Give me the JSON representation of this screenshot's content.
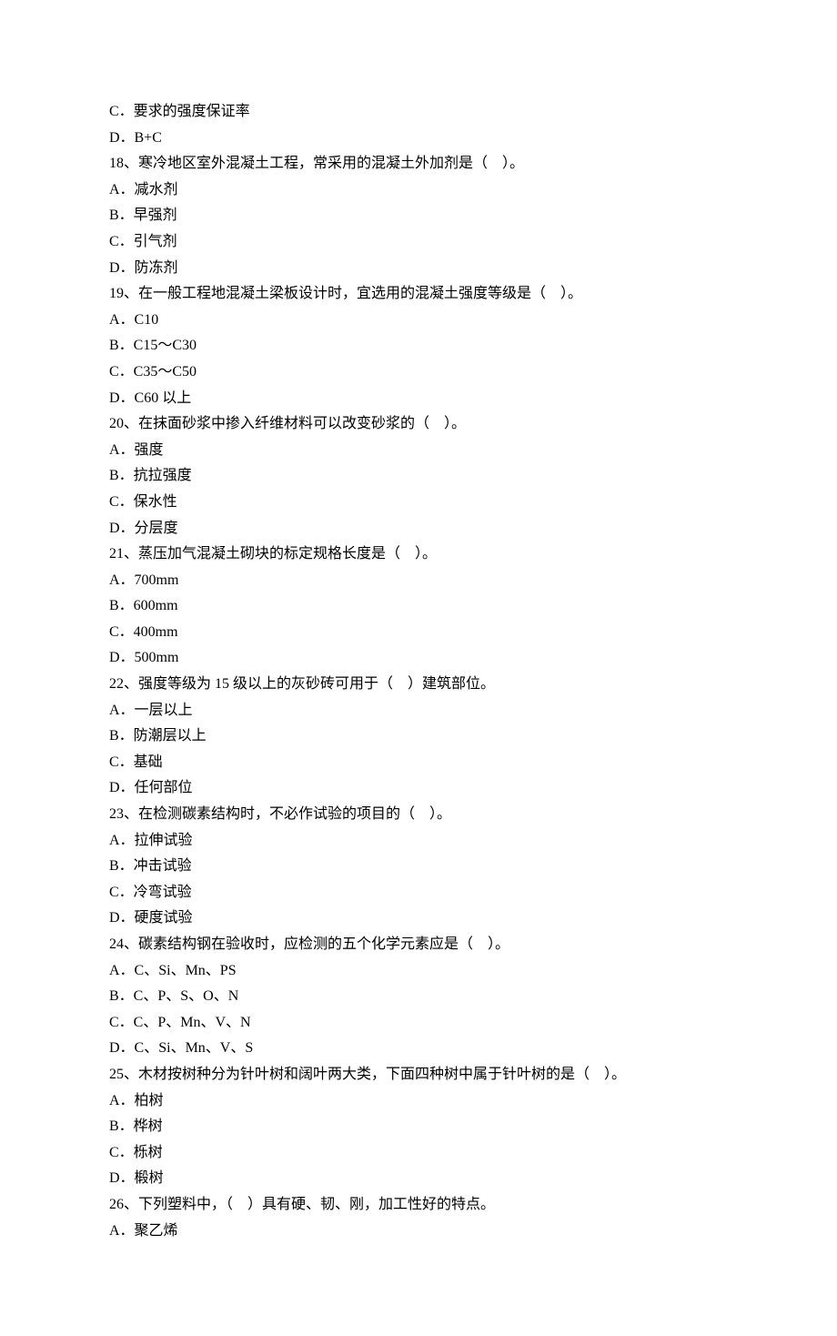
{
  "lines": [
    {
      "type": "option",
      "text": "C．要求的强度保证率"
    },
    {
      "type": "option",
      "text": "D．B+C"
    },
    {
      "type": "question",
      "text": "18、寒冷地区室外混凝土工程，常采用的混凝土外加剂是（　）。"
    },
    {
      "type": "option",
      "text": "A．减水剂"
    },
    {
      "type": "option",
      "text": "B．早强剂"
    },
    {
      "type": "option",
      "text": "C．引气剂"
    },
    {
      "type": "option",
      "text": "D．防冻剂"
    },
    {
      "type": "question",
      "text": "19、在一般工程地混凝土梁板设计时，宜选用的混凝土强度等级是（　）。"
    },
    {
      "type": "option",
      "text": "A．C10"
    },
    {
      "type": "option",
      "text": "B．C15～C30"
    },
    {
      "type": "option",
      "text": "C．C35～C50"
    },
    {
      "type": "option",
      "text": "D．C60 以上"
    },
    {
      "type": "question",
      "text": "20、在抹面砂浆中掺入纤维材料可以改变砂浆的（　）。"
    },
    {
      "type": "option",
      "text": "A．强度"
    },
    {
      "type": "option",
      "text": "B．抗拉强度"
    },
    {
      "type": "option",
      "text": "C．保水性"
    },
    {
      "type": "option",
      "text": "D．分层度"
    },
    {
      "type": "question",
      "text": "21、蒸压加气混凝土砌块的标定规格长度是（　）。"
    },
    {
      "type": "option",
      "text": "A．700mm"
    },
    {
      "type": "option",
      "text": "B．600mm"
    },
    {
      "type": "option",
      "text": "C．400mm"
    },
    {
      "type": "option",
      "text": "D．500mm"
    },
    {
      "type": "question",
      "text": "22、强度等级为 15 级以上的灰砂砖可用于（　）建筑部位。"
    },
    {
      "type": "option",
      "text": "A．一层以上"
    },
    {
      "type": "option",
      "text": "B．防潮层以上"
    },
    {
      "type": "option",
      "text": "C．基础"
    },
    {
      "type": "option",
      "text": "D．任何部位"
    },
    {
      "type": "question",
      "text": "23、在检测碳素结构时，不必作试验的项目的（　）。"
    },
    {
      "type": "option",
      "text": "A．拉伸试验"
    },
    {
      "type": "option",
      "text": "B．冲击试验"
    },
    {
      "type": "option",
      "text": "C．冷弯试验"
    },
    {
      "type": "option",
      "text": "D．硬度试验"
    },
    {
      "type": "question",
      "text": "24、碳素结构钢在验收时，应检测的五个化学元素应是（　）。"
    },
    {
      "type": "option",
      "text": "A．C、Si、Mn、PS"
    },
    {
      "type": "option",
      "text": "B．C、P、S、O、N"
    },
    {
      "type": "option",
      "text": "C．C、P、Mn、V、N"
    },
    {
      "type": "option",
      "text": "D．C、Si、Mn、V、S"
    },
    {
      "type": "question",
      "text": "25、木材按树种分为针叶树和阔叶两大类，下面四种树中属于针叶树的是（　）。"
    },
    {
      "type": "option",
      "text": "A．柏树"
    },
    {
      "type": "option",
      "text": "B．桦树"
    },
    {
      "type": "option",
      "text": "C．栎树"
    },
    {
      "type": "option",
      "text": "D．椴树"
    },
    {
      "type": "question",
      "text": "26、下列塑料中，（　）具有硬、韧、刚，加工性好的特点。"
    },
    {
      "type": "option",
      "text": "A．聚乙烯"
    }
  ]
}
